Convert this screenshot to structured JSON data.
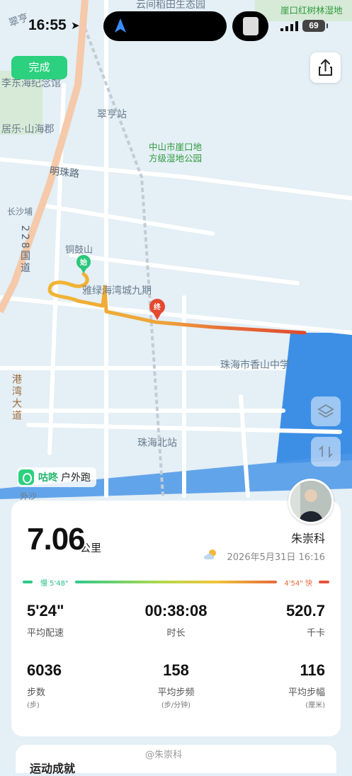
{
  "status": {
    "time": "16:55",
    "battery": "69"
  },
  "map": {
    "labels": {
      "park_top": "云间稻田生态园",
      "mangrove": "崖口红树林湿地",
      "cuiheng_top": "翠亨",
      "memorial": "李东海纪念馆",
      "juling": "居乐·山海郡",
      "station": "翠亨站",
      "wetland_park": "中山市崖口地方级湿地公园",
      "mingzhu_road": "明珠路",
      "changshapu": "长沙埔",
      "national_road": "228国道",
      "tonggushan": "铜鼓山",
      "haiwan": "雅绿海湾城九期",
      "school": "珠海市香山中学",
      "gangwan": "港湾大道",
      "zhuhai_north": "珠海北站",
      "waisha": "外沙"
    },
    "start_marker": "始",
    "end_marker": "终"
  },
  "buttons": {
    "done": "完成"
  },
  "brand": {
    "name": "咕咚",
    "sub": "户外跑"
  },
  "summary": {
    "distance": "7.06",
    "distance_unit": "公里",
    "user": "朱崇科",
    "datetime": "2026年5月31日 16:16",
    "pace_slow": "慢 5'48\"",
    "pace_fast": "4'54\" 快"
  },
  "stats": [
    {
      "value": "5'24\"",
      "label": "平均配速",
      "sub": ""
    },
    {
      "value": "00:38:08",
      "label": "时长",
      "sub": ""
    },
    {
      "value": "520.7",
      "label": "千卡",
      "sub": ""
    },
    {
      "value": "6036",
      "label": "步数",
      "sub": "(步)"
    },
    {
      "value": "158",
      "label": "平均步频",
      "sub": "(步/分钟)"
    },
    {
      "value": "116",
      "label": "平均步幅",
      "sub": "(厘米)"
    }
  ],
  "watermark": "@朱崇科",
  "bottom_title": "运动成就",
  "colors": {
    "accent": "#2bd17e",
    "sea": "#3d8fe6",
    "route_slow": "#f0b429",
    "route_fast": "#e04a2f"
  }
}
